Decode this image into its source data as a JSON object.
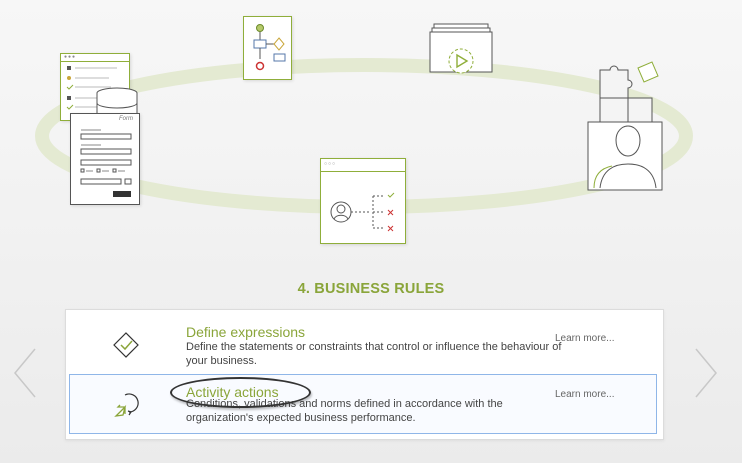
{
  "illustration": {
    "form_title": "Form"
  },
  "section": {
    "title": "4. BUSINESS RULES"
  },
  "items": [
    {
      "title": "Define expressions",
      "description": "Define the statements or constraints that control or influence the behaviour of your business.",
      "link": "Learn more...",
      "icon": "diamond-check-icon"
    },
    {
      "title": "Activity actions",
      "description": "Conditions, validations and norms defined in accordance with the organization's expected business performance.",
      "link": "Learn more...",
      "icon": "cursor-action-icon"
    }
  ],
  "navigation": {
    "prev_icon": "chevron-left-icon",
    "next_icon": "chevron-right-icon"
  },
  "colors": {
    "accent_green": "#8aa53a",
    "selection_blue": "#8fb6e8",
    "text": "#444444"
  }
}
